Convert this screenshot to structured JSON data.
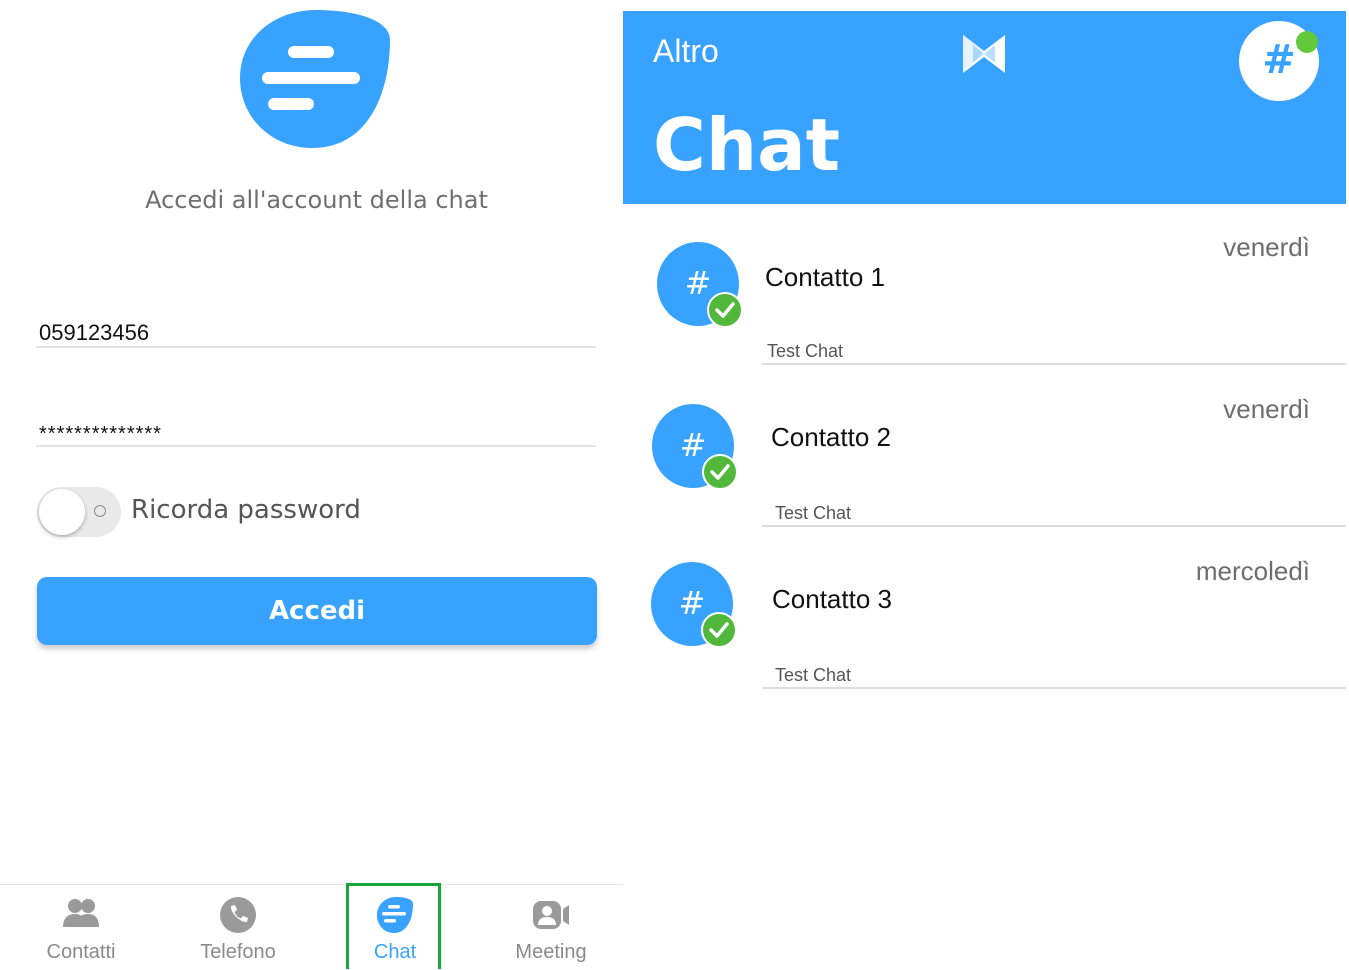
{
  "login": {
    "title": "Accedi all'account della chat",
    "username_value": "059123456",
    "password_value": "**************",
    "remember_label": "Ricorda password",
    "remember_enabled": false,
    "submit_label": "Accedi"
  },
  "tabbar": {
    "tabs": [
      {
        "label": "Contatti",
        "icon": "contacts-icon"
      },
      {
        "label": "Telefono",
        "icon": "phone-icon"
      },
      {
        "label": "Chat",
        "icon": "chat-icon"
      },
      {
        "label": "Meeting",
        "icon": "meeting-icon"
      }
    ],
    "active": "Chat"
  },
  "chat_screen": {
    "back_label": "Altro",
    "title": "Chat",
    "avatar_symbol": "#",
    "online_status_color": "#63c83a",
    "chats": [
      {
        "name": "Contatto 1",
        "time": "venerdì",
        "preview": "Test Chat",
        "avatar_symbol": "#"
      },
      {
        "name": "Contatto 2",
        "time": "venerdì",
        "preview": "Test Chat",
        "avatar_symbol": "#"
      },
      {
        "name": "Contatto 3",
        "time": "mercoledì",
        "preview": "Test Chat",
        "avatar_symbol": "#"
      }
    ]
  },
  "colors": {
    "accent": "#37a2ff",
    "online": "#63c83a",
    "active_tab_highlight": "#1aa53a"
  }
}
